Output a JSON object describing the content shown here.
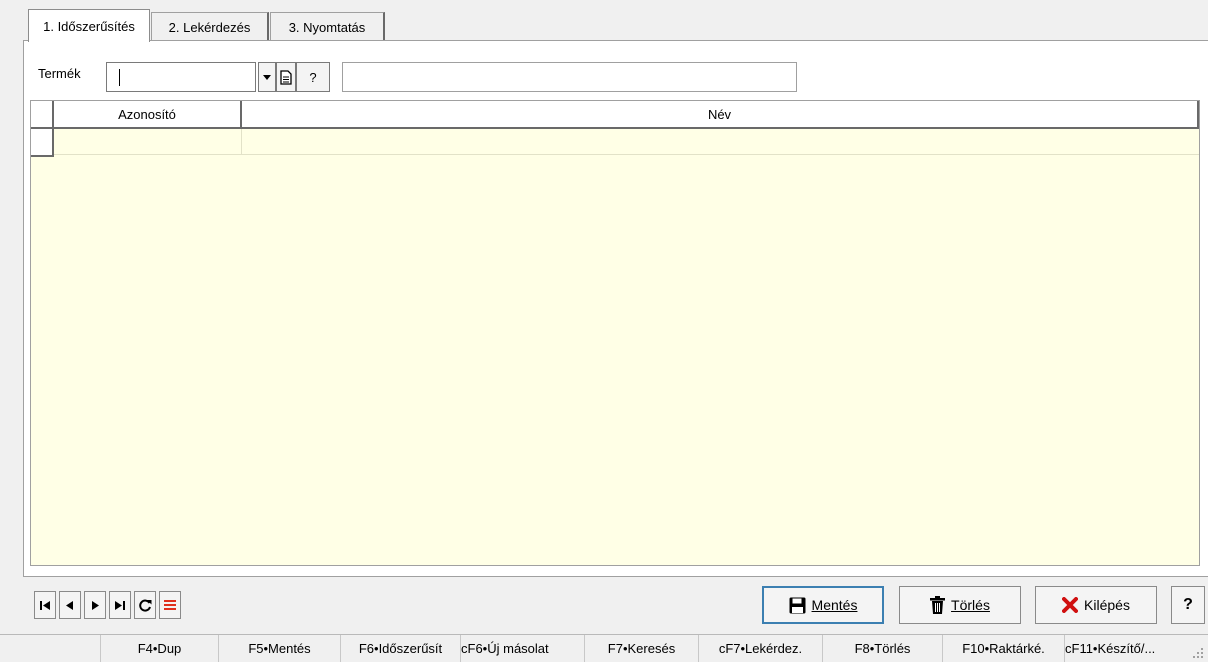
{
  "tabs": [
    {
      "label": "1. Időszerűsítés",
      "active": true
    },
    {
      "label": "2. Lekérdezés",
      "active": false
    },
    {
      "label": "3. Nyomtatás",
      "active": false
    }
  ],
  "filter": {
    "termek_label": "Termék",
    "termek_value": "",
    "nev_value": "",
    "help_label": "?"
  },
  "grid": {
    "columns": [
      "Azonosító",
      "Név"
    ],
    "rows": 1,
    "background": "#ffffe6"
  },
  "nav_buttons": [
    "first-record-icon",
    "prev-record-icon",
    "next-record-icon",
    "last-record-icon",
    "refresh-icon",
    "list-icon"
  ],
  "actions": {
    "save_label": "Mentés",
    "delete_label": "Törlés",
    "exit_label": "Kilépés",
    "help_label": "?"
  },
  "fkeys": [
    "F4•Dup",
    "F5•Mentés",
    "F6•Időszerűsít",
    "cF6•Új másolat",
    "F7•Keresés",
    "cF7•Lekérdez.",
    "F8•Törlés",
    "F10•Raktárké.",
    "cF11•Készítő/..."
  ],
  "colors": {
    "exit_icon": "#d01010",
    "list_icon": "#e0301e",
    "focus_border": "#3c7fb1"
  }
}
